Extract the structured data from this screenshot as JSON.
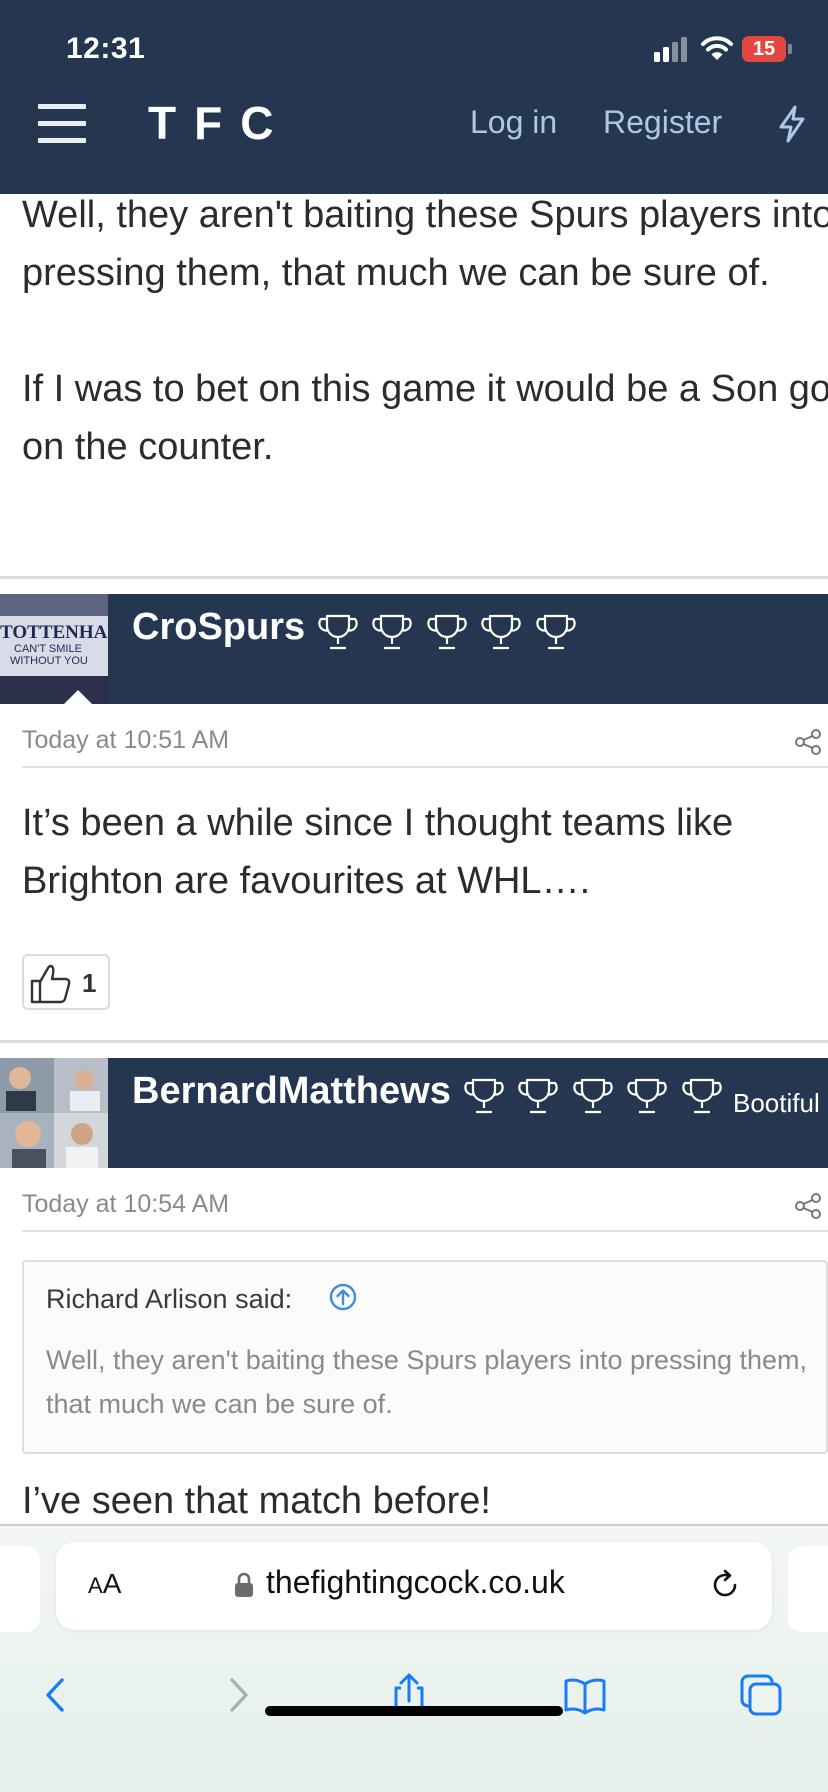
{
  "status_bar": {
    "time": "12:31",
    "battery": "15"
  },
  "nav": {
    "logo": "TFC",
    "login": "Log in",
    "register": "Register"
  },
  "posts": [
    {
      "text_lines": [
        "Well, they aren't baiting these Spurs players into",
        "pressing them, that much we can be sure of.",
        "If I was to bet on this game it would be a Son goal",
        "on the counter."
      ]
    },
    {
      "username": "CroSpurs",
      "trophy_count": 5,
      "avatar_text": [
        "TOTTENHAM",
        "CAN'T SMILE",
        "WITHOUT YOU"
      ],
      "timestamp": "Today at 10:51 AM",
      "text_lines": [
        "It’s been a while since I thought teams like",
        "Brighton are favourites at WHL…."
      ],
      "reaction_count": "1"
    },
    {
      "username": "BernardMatthews",
      "trophy_count": 5,
      "user_title": "Bootiful",
      "timestamp": "Today at 10:54 AM",
      "quote": {
        "author": "Richard Arlison said:",
        "lines": [
          "Well, they aren't baiting these Spurs players into pressing them,",
          "that much we can be sure of."
        ]
      },
      "text_lines": [
        "I’ve seen that match before!"
      ]
    }
  ],
  "browser": {
    "aa_label": "AA",
    "url": "thefightingcock.co.uk"
  },
  "icons": {
    "menu": "hamburger-icon",
    "bolt": "lightning-icon",
    "trophy": "trophy-icon",
    "share": "share-icon",
    "like": "thumbs-up-icon",
    "quote_jump": "arrow-up-circle-icon",
    "lock": "lock-icon",
    "reload": "reload-icon",
    "back": "chevron-left-icon",
    "forward": "chevron-right-icon",
    "share_sheet": "share-sheet-icon",
    "bookmarks": "book-icon",
    "tabs": "tabs-icon"
  },
  "colors": {
    "header_bg": "#243650",
    "nav_link": "#aec7e6",
    "battery": "#e4473f",
    "ios_blue": "#1a7cf5"
  }
}
